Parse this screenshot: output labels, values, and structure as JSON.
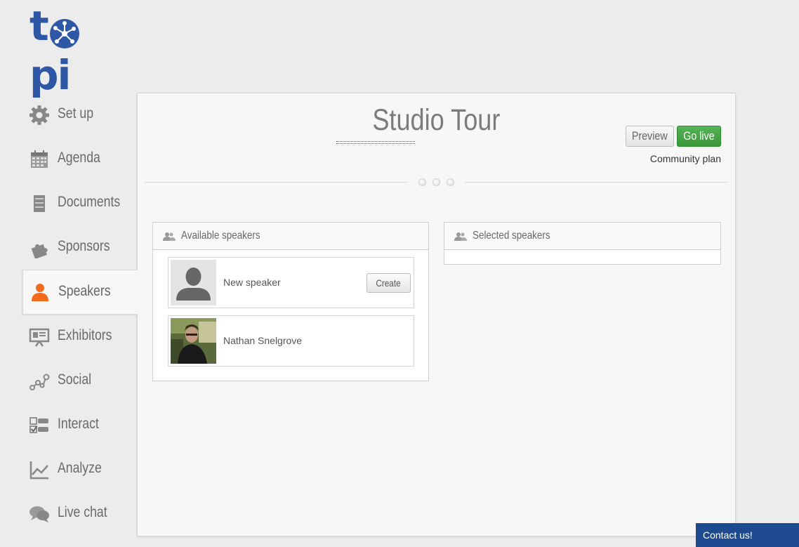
{
  "logo": {
    "text": "topi",
    "brand_color": "#2e57a6"
  },
  "sidebar": {
    "items": [
      {
        "label": "Set up",
        "icon": "gear-icon",
        "active": false
      },
      {
        "label": "Agenda",
        "icon": "calendar-icon",
        "active": false
      },
      {
        "label": "Documents",
        "icon": "documents-icon",
        "active": false
      },
      {
        "label": "Sponsors",
        "icon": "puzzle-icon",
        "active": false
      },
      {
        "label": "Speakers",
        "icon": "person-icon",
        "active": true
      },
      {
        "label": "Exhibitors",
        "icon": "presentation-board-icon",
        "active": false
      },
      {
        "label": "Social",
        "icon": "social-network-icon",
        "active": false
      },
      {
        "label": "Interact",
        "icon": "checklist-icon",
        "active": false
      },
      {
        "label": "Analyze",
        "icon": "line-chart-icon",
        "active": false
      },
      {
        "label": "Live chat",
        "icon": "chat-bubbles-icon",
        "active": false
      }
    ],
    "active_color": "#f26b1d"
  },
  "header": {
    "title": "Studio Tour",
    "preview_label": "Preview",
    "golive_label": "Go live",
    "plan": "Community plan"
  },
  "available": {
    "title": "Available speakers",
    "icon": "people-icon",
    "cards": [
      {
        "name": "New speaker",
        "action": "Create",
        "avatar": "default-avatar-icon"
      },
      {
        "name": "Nathan Snelgrove",
        "avatar": "photo"
      }
    ]
  },
  "selected": {
    "title": "Selected speakers",
    "icon": "people-icon"
  },
  "contact": {
    "label": "Contact us!"
  },
  "colors": {
    "go_live": "#44a544",
    "contact_bg": "#1e4b8f"
  }
}
